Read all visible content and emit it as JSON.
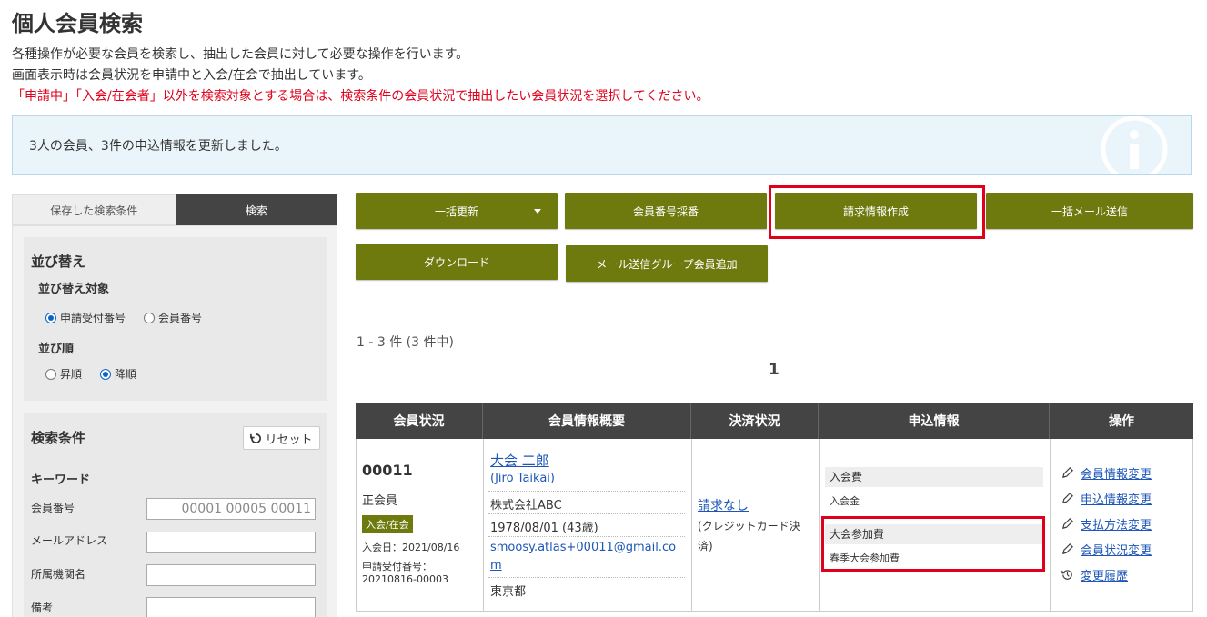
{
  "page": {
    "title": "個人会員検索",
    "desc1": "各種操作が必要な会員を検索し、抽出した会員に対して必要な操作を行います。",
    "desc2": "画面表示時は会員状況を申請中と入会/在会で抽出しています。",
    "warn": "「申請中」「入会/在会者」以外を検索対象とする場合は、検索条件の会員状況で抽出したい会員状況を選択してください。",
    "info_message": "3人の会員、3件の申込情報を更新しました。"
  },
  "left": {
    "tab_saved": "保存した検索条件",
    "tab_search": "検索",
    "sort_title": "並び替え",
    "sort_target_label": "並び替え対象",
    "sort_target_opt1": "申請受付番号",
    "sort_target_opt2": "会員番号",
    "sort_order_label": "並び順",
    "sort_order_opt1": "昇順",
    "sort_order_opt2": "降順",
    "cond_title": "検索条件",
    "reset_label": "リセット",
    "keyword_label": "キーワード",
    "field_member_no": "会員番号",
    "field_member_no_value": "00001 00005 00011",
    "field_email": "メールアドレス",
    "field_org": "所属機関名",
    "field_note": "備考"
  },
  "actions": {
    "bulk_update": "一括更新",
    "assign_no": "会員番号採番",
    "create_invoice": "請求情報作成",
    "bulk_mail": "一括メール送信",
    "download": "ダウンロード",
    "add_mail_group": "メール送信グループ会員追加"
  },
  "results": {
    "count": "1 - 3 件 (3 件中)",
    "page": "1"
  },
  "table": {
    "headers": [
      "会員状況",
      "会員情報概要",
      "決済状況",
      "申込情報",
      "操作"
    ],
    "row": {
      "member_no": "00011",
      "member_type": "正会員",
      "status_badge": "入会/在会",
      "join_date": "入会日：2021/08/16",
      "app_no_label": "申請受付番号：",
      "app_no": "20210816-00003",
      "name": "大会 二郎",
      "name_en": "(Jiro Taikai)",
      "company": "株式会社ABC",
      "birth": "1978/08/01 (43歳)",
      "email_l1": "smoosy.atlas+00011@gmail.co",
      "email_l2": "m",
      "pref": "東京都",
      "pay_status": "請求なし",
      "pay_method_l1": "(クレジットカード決",
      "pay_method_l2": "済)",
      "apply1_title": "入会費",
      "apply1_item": "入会金",
      "apply2_title": "大会参加費",
      "apply2_item": "春季大会参加費",
      "op1": "会員情報変更",
      "op2": "申込情報変更",
      "op3": "支払方法変更",
      "op4": "会員状況変更",
      "op5": "変更履歴"
    }
  },
  "colors": {
    "accent": "#6e7a0e",
    "highlight": "#e0001b",
    "link": "#1d56b8"
  }
}
